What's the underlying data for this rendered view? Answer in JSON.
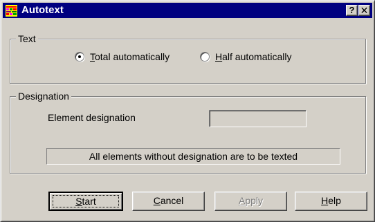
{
  "window": {
    "title": "Autotext",
    "help_button": "?",
    "close_button": "✕",
    "icon": "autotext-app-icon"
  },
  "text_group": {
    "label": "Text",
    "options": [
      {
        "label": "Total automatically",
        "checked": true
      },
      {
        "label": "Half automatically",
        "checked": false
      }
    ]
  },
  "designation_group": {
    "label": "Designation",
    "element_label": "Element designation",
    "element_value": "",
    "info": "All elements without designation are to be texted"
  },
  "buttons": {
    "start": "Start",
    "cancel": "Cancel",
    "apply": "Apply",
    "help": "Help"
  },
  "colors": {
    "titlebar": "#000080",
    "face": "#d4d0c8"
  }
}
